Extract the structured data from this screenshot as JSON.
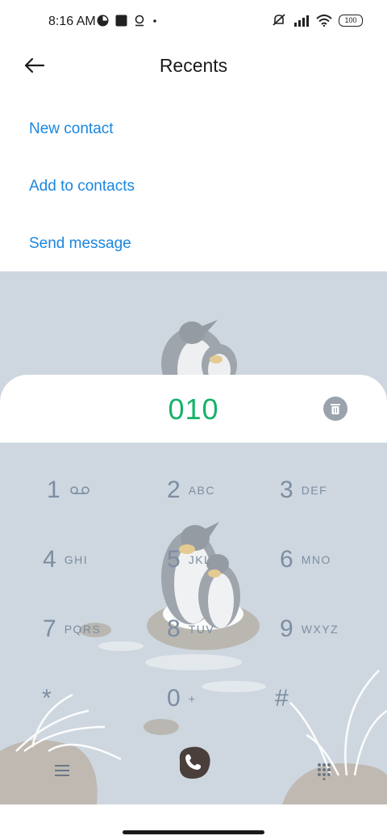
{
  "status_bar": {
    "time": "8:16 AM",
    "battery": "100",
    "icons": [
      "clock-app-icon",
      "square-icon",
      "location-icon",
      "dot-icon",
      "mute-icon",
      "signal-icon",
      "wifi-icon",
      "battery-icon"
    ]
  },
  "header": {
    "title": "Recents",
    "back_icon": "arrow-left-icon"
  },
  "actions": {
    "new_contact": "New contact",
    "add_to_contacts": "Add to contacts",
    "send_message": "Send message"
  },
  "dialer": {
    "number": "010",
    "number_color": "#15b36a",
    "keys": [
      {
        "digit": "1",
        "letters": "voicemail"
      },
      {
        "digit": "2",
        "letters": "ABC"
      },
      {
        "digit": "3",
        "letters": "DEF"
      },
      {
        "digit": "4",
        "letters": "GHI"
      },
      {
        "digit": "5",
        "letters": "JKL"
      },
      {
        "digit": "6",
        "letters": "MNO"
      },
      {
        "digit": "7",
        "letters": "PQRS"
      },
      {
        "digit": "8",
        "letters": "TUV"
      },
      {
        "digit": "9",
        "letters": "WXYZ"
      },
      {
        "digit": "*",
        "letters": ""
      },
      {
        "digit": "0",
        "letters": "+"
      },
      {
        "digit": "#",
        "letters": ""
      }
    ],
    "bottom": {
      "menu_icon": "menu-icon",
      "call_icon": "phone-icon",
      "keypad_icon": "dialpad-icon"
    }
  },
  "colors": {
    "accent": "#1a86e0",
    "wallpaper": "#ced7e0",
    "key_text": "#7c8da1"
  }
}
